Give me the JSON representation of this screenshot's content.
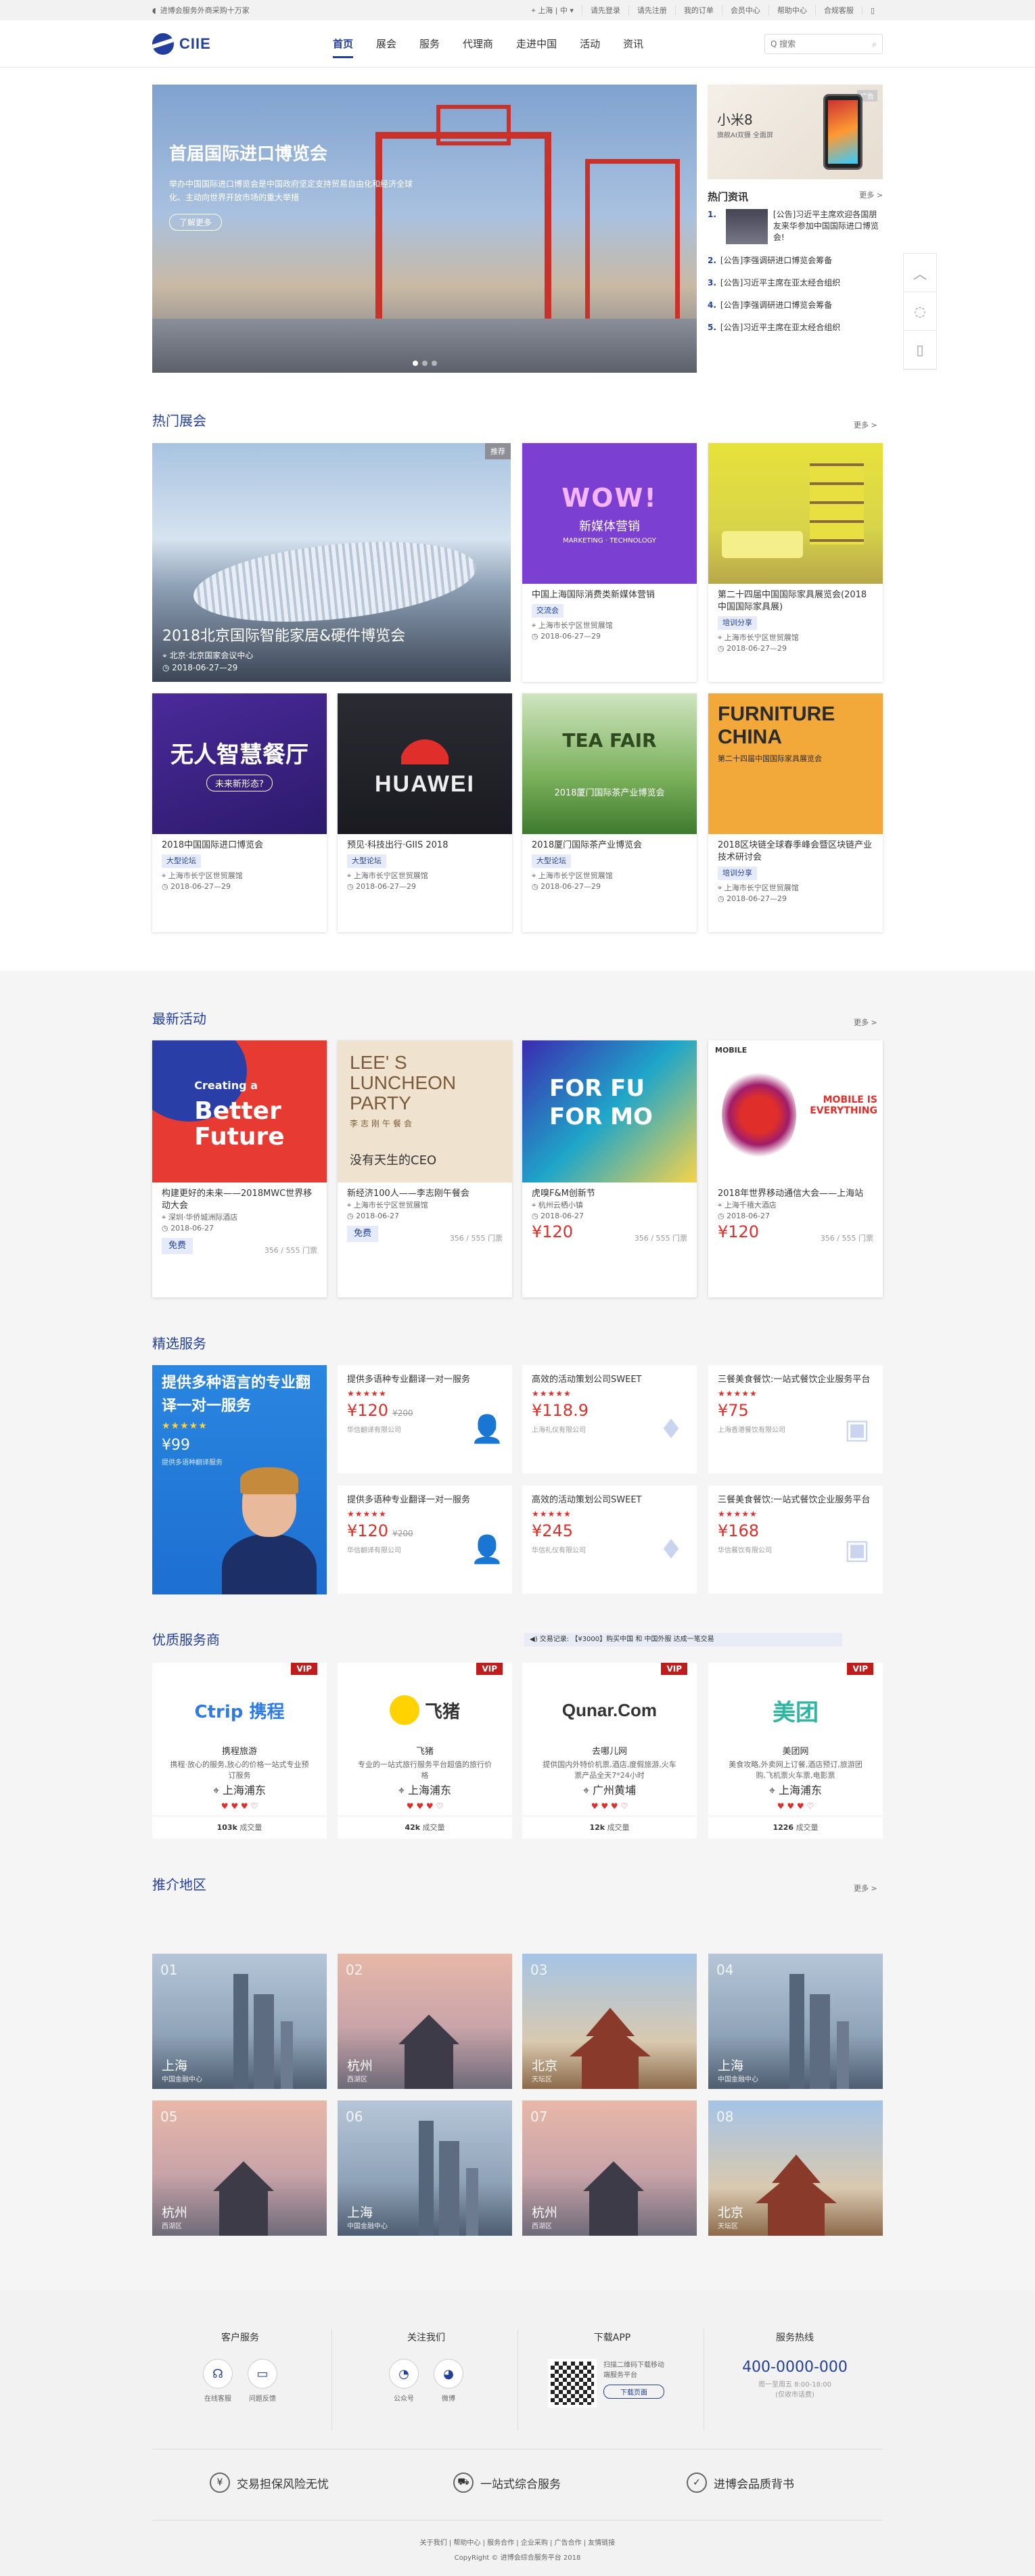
{
  "topbar": {
    "welcome": "进博会服务外商采购十万家",
    "location": "上海",
    "lang": "中",
    "links": [
      "请先登录",
      "请先注册",
      "我的订单",
      "会员中心",
      "帮助中心",
      "合规客服"
    ]
  },
  "logo": {
    "text": "CIIE"
  },
  "nav": [
    "首页",
    "展会",
    "服务",
    "代理商",
    "走进中国",
    "活动",
    "资讯"
  ],
  "search": {
    "placeholder": "Q 搜索"
  },
  "hero": {
    "title": "首届国际进口博览会",
    "desc": "举办中国国际进口博览会是中国政府坚定支持贸易自由化和经济全球化、主动向世界开放市场的重大举措",
    "more": "了解更多"
  },
  "side_ad": {
    "title": "小米8",
    "tag": "广告",
    "sub": "旗舰AI双摄 全面屏"
  },
  "hot_news": {
    "title": "热门资讯",
    "more": "更多 >",
    "first": "[公告]习近平主席欢迎各国朋友来华参加中国国际进口博览会!",
    "items": [
      {
        "n": "2.",
        "t": "[公告]李强调研进口博览会筹备"
      },
      {
        "n": "3.",
        "t": "[公告]习近平主席在亚太经合组织"
      },
      {
        "n": "4.",
        "t": "[公告]李强调研进口博览会筹备"
      },
      {
        "n": "5.",
        "t": "[公告]习近平主席在亚太经合组织"
      }
    ]
  },
  "float": [
    "^",
    "chat",
    "phone"
  ],
  "hot_exh": {
    "title": "热门展会",
    "more": "更多 >",
    "big": {
      "tag": "推荐",
      "title": "2018北京国际智能家居&硬件博览会",
      "loc": "北京·北京国家会议中心",
      "date": "2018-06-27—29"
    },
    "cards": [
      {
        "title": "中国上海国际消费类新媒体营销",
        "badge": "交流会",
        "loc": "上海市长宁区世贸展馆",
        "date": "2018-06-27—29",
        "img": "WOW! 新媒体营销"
      },
      {
        "title": "第二十四届中国国际家具展览会(2018中国国际家具展)",
        "badge": "培训分享",
        "loc": "上海市长宁区世贸展馆",
        "date": "2018-06-27—29",
        "img": ""
      },
      {
        "title": "2018中国国际进口博览会",
        "badge": "大型论坛",
        "loc": "上海市长宁区世贸展馆",
        "date": "2018-06-27—29",
        "img": "无人智慧餐厅"
      },
      {
        "title": "预见·科技出行·GIIS 2018",
        "badge": "大型论坛",
        "loc": "上海市长宁区世贸展馆",
        "date": "2018-06-27—29",
        "img": "HUAWEI"
      },
      {
        "title": "2018厦门国际茶产业博览会",
        "badge": "大型论坛",
        "loc": "上海市长宁区世贸展馆",
        "date": "2018-06-27—29",
        "img": "TEA FAIR"
      },
      {
        "title": "2018区块链全球春季峰会暨区块链产业技术研讨会",
        "badge": "培训分享",
        "loc": "上海市长宁区世贸展馆",
        "date": "2018-06-27—29",
        "img": "FURNITURE CHINA"
      }
    ]
  },
  "activities": {
    "title": "最新活动",
    "more": "更多 >",
    "items": [
      {
        "title": "构建更好的未来——2018MWC世界移动大会",
        "loc": "深圳·华侨城洲际酒店",
        "date": "2018-06-27",
        "price": "免费",
        "count": "356 / 555 门票",
        "img": "Creating a Better Future"
      },
      {
        "title": "新经济100人——李志刚午餐会",
        "loc": "上海市长宁区世贸展馆",
        "date": "2018-06-27",
        "price": "免费",
        "count": "356 / 555 门票",
        "img": "LEE'S LUNCHEON PARTY"
      },
      {
        "title": "虎嗅F&M创新节",
        "loc": "杭州云栖小镇",
        "date": "2018-06-27",
        "price": "¥120",
        "count": "356 / 555 门票",
        "img": "FOR FUN FOR MORE"
      },
      {
        "title": "2018年世界移动通信大会——上海站",
        "loc": "上海千禧大酒店",
        "date": "2018-06-27",
        "price": "¥120",
        "count": "356 / 555 门票",
        "img": "MOBILE IS EVERYTHING"
      }
    ]
  },
  "services": {
    "title": "精选服务",
    "big": {
      "title": "提供多种语言的专业翻译一对一服务",
      "stars": "★★★★★",
      "price": "¥99",
      "sub": "提供多语种翻译服务"
    },
    "items": [
      {
        "title": "提供多语种专业翻译一对一服务",
        "stars": "★★★★★",
        "price": "¥120",
        "old": "¥200",
        "co": "华信翻译有限公司",
        "ic": "person"
      },
      {
        "title": "高效的活动策划公司SWEET",
        "stars": "★★★★★",
        "price": "¥118.9",
        "old": "",
        "co": "上海礼仪有限公司",
        "ic": "tie"
      },
      {
        "title": "三餐美食餐饮:一站式餐饮企业服务平台",
        "stars": "★★★★★",
        "price": "¥75",
        "old": "",
        "co": "上海香港餐饮有限公司",
        "ic": "bag"
      },
      {
        "title": "提供多语种专业翻译一对一服务",
        "stars": "★★★★★",
        "price": "¥120",
        "old": "¥200",
        "co": "华信翻译有限公司",
        "ic": "person"
      },
      {
        "title": "高效的活动策划公司SWEET",
        "stars": "★★★★★",
        "price": "¥245",
        "old": "",
        "co": "华信礼仪有限公司",
        "ic": "tie"
      },
      {
        "title": "三餐美食餐饮:一站式餐饮企业服务平台",
        "stars": "★★★★★",
        "price": "¥168",
        "old": "",
        "co": "华信餐饮有限公司",
        "ic": "bag"
      }
    ]
  },
  "vendors": {
    "title": "优质服务商",
    "ticker": "交易记录: 【¥3000】购买中国 和 中国外服 达成一笔交易",
    "items": [
      {
        "logo": "Ctrip 携程",
        "name": "携程旅游",
        "desc": "携程·放心的服务,放心的价格一站式专业预订服务",
        "loc": "上海浦东",
        "deals": "103k",
        "color": "#2d7be5"
      },
      {
        "logo": "飞猪",
        "name": "飞猪",
        "desc": "专业的一站式旅行服务平台超值的旅行价格",
        "loc": "上海浦东",
        "deals": "42k",
        "color": "#333"
      },
      {
        "logo": "Qunar.Com",
        "name": "去哪儿网",
        "desc": "提供国内外特价机票,酒店,度假旅游,火车票产品全天7*24小时",
        "loc": "广州黄埔",
        "deals": "12k",
        "color": "#333"
      },
      {
        "logo": "美团",
        "name": "美团网",
        "desc": "美食攻略,外卖网上订餐,酒店预订,旅游团购,飞机票火车票,电影票",
        "loc": "上海浦东",
        "deals": "1226",
        "color": "#2fb6a3"
      }
    ],
    "deals_suffix": "成交量"
  },
  "regions": {
    "title": "推介地区",
    "more": "更多 >",
    "items": [
      {
        "num": "01",
        "city": "上海",
        "sub": "中国金融中心"
      },
      {
        "num": "02",
        "city": "杭州",
        "sub": "西湖区"
      },
      {
        "num": "03",
        "city": "北京",
        "sub": "天坛区"
      },
      {
        "num": "04",
        "city": "上海",
        "sub": "中国金融中心"
      },
      {
        "num": "05",
        "city": "杭州",
        "sub": "西湖区"
      },
      {
        "num": "06",
        "city": "上海",
        "sub": "中国金融中心"
      },
      {
        "num": "07",
        "city": "杭州",
        "sub": "西湖区"
      },
      {
        "num": "08",
        "city": "北京",
        "sub": "天坛区"
      }
    ]
  },
  "footer": {
    "service": {
      "title": "客户服务",
      "a": "在线客服",
      "b": "问题反馈"
    },
    "follow": {
      "title": "关注我们",
      "a": "公众号",
      "b": "微博"
    },
    "app": {
      "title": "下载APP",
      "desc": "扫描二维码下载移动端服务平台",
      "btn": "下载页面"
    },
    "hotline": {
      "title": "服务热线",
      "num": "400-0000-000",
      "time": "周一至周五 8:00-18:00",
      "note": "(仅收市话费)"
    },
    "guar": [
      "交易担保风险无忧",
      "一站式综合服务",
      "进博会品质背书"
    ],
    "links": "关于我们 | 帮助中心 | 服务合作 | 企业采购 | 广告合作 | 友情链接",
    "copy": "CopyRight © 进博会综合服务平台 2018"
  }
}
